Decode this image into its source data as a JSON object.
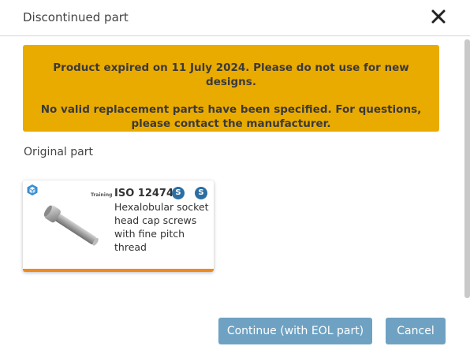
{
  "dialog": {
    "title": "Discontinued part",
    "close_icon": "close-icon"
  },
  "warning": {
    "line1": "Product expired on 11 July 2024. Please do not use for new designs.",
    "line2": "No valid replacement parts have been specified. For questions, please contact the manufacturer.",
    "color": "#eaab00"
  },
  "original_part": {
    "label": "Original part",
    "card": {
      "tag": "Training",
      "code": "ISO 12474",
      "description": "Hexalobular socket head cap screws with fine pitch thread",
      "badge1": "S",
      "badge2": "S",
      "accent_color": "#f0891e",
      "icons": [
        "cube-icon",
        "part-image"
      ]
    }
  },
  "buttons": {
    "continue_label": "Continue (with EOL part)",
    "cancel_label": "Cancel",
    "color": "#6fa2c2"
  }
}
